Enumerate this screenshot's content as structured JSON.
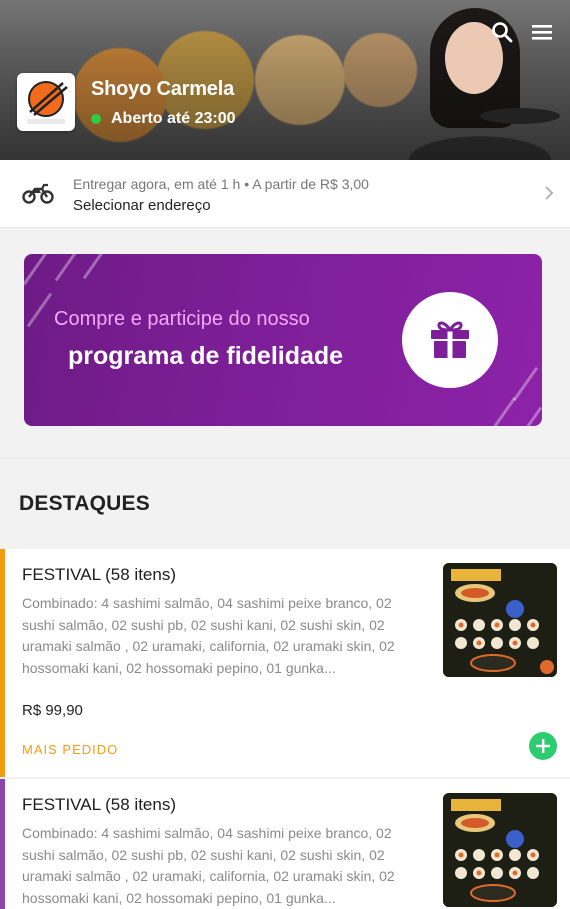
{
  "header": {
    "store_name": "Shoyo Carmela",
    "status_text": "Aberto até 23:00",
    "status_color": "#2ecc40",
    "icons": [
      "search-icon",
      "menu-icon"
    ]
  },
  "delivery": {
    "line1": "Entregar agora, em até 1 h  •  A partir de R$ 3,00",
    "line2": "Selecionar endereço",
    "icons": [
      "motorcycle-icon",
      "chevron-right-icon"
    ]
  },
  "banner": {
    "line_a": "Compre e participe do nosso",
    "line_b": "programa de fidelidade",
    "icon": "gift-icon",
    "color_start": "#6e1b86",
    "color_end": "#8d22a8"
  },
  "section": {
    "title": "DESTAQUES"
  },
  "products": [
    {
      "title": "FESTIVAL (58 itens)",
      "description": "Combinado: 4 sashimi salmão, 04 sashimi peixe branco, 02 sushi salmão, 02 sushi pb, 02 sushi kani, 02 sushi skin, 02 uramaki salmão , 02 uramaki, california, 02 uramaki skin, 02 hossomaki kani, 02 hossomaki pepino, 01 gunka...",
      "price": "R$ 99,90",
      "badge": "MAIS PEDIDO",
      "accent": "#f39c12"
    },
    {
      "title": "FESTIVAL (58 itens)",
      "description": "Combinado: 4 sashimi salmão, 04 sashimi peixe branco, 02 sushi salmão, 02 sushi pb, 02 sushi kani, 02 sushi skin, 02 uramaki salmão , 02 uramaki, california, 02 uramaki skin, 02 hossomaki kani, 02 hossomaki pepino, 01 gunka...",
      "accent": "#8e44ad"
    }
  ]
}
